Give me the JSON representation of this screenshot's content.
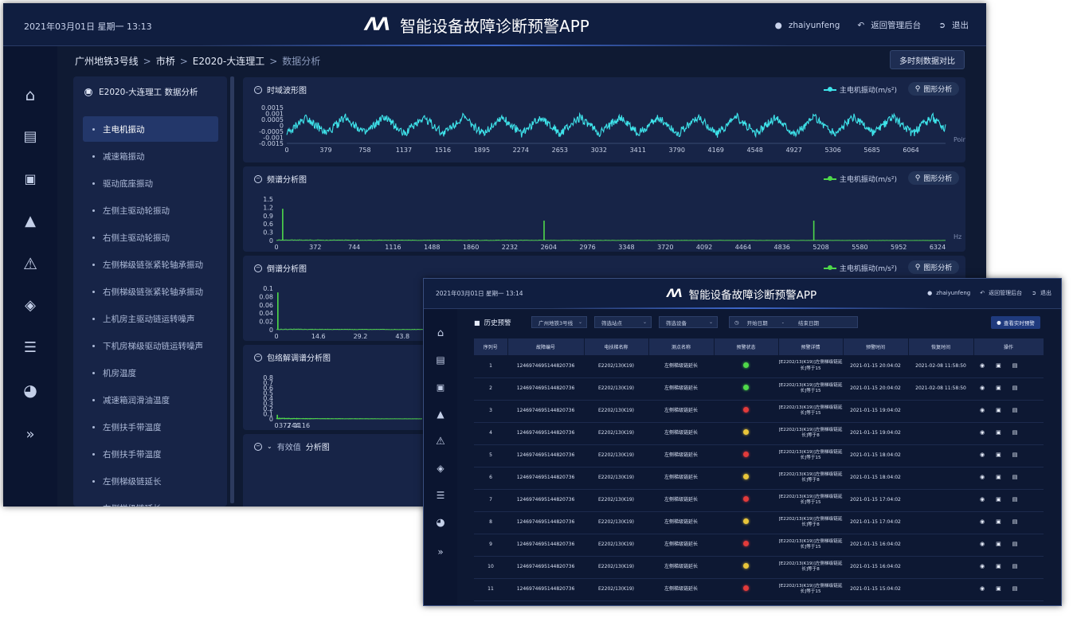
{
  "w1": {
    "datetime": "2021年03月01日 星期一 13:13",
    "title": "智能设备故障诊断预警APP",
    "logo": "ΛΛ",
    "user": "zhaiyunfeng",
    "back_admin": "返回管理后台",
    "logout": "退出",
    "breadcrumb": [
      "广州地铁3号线",
      "市桥",
      "E2020-大连理工",
      "数据分析"
    ],
    "multi_compare": "多时刻数据对比",
    "point_panel_title": "E2020-大连理工 数据分析",
    "points": [
      "主电机振动",
      "减速箱振动",
      "驱动底座振动",
      "左侧主驱动轮振动",
      "右侧主驱动轮振动",
      "左侧梯级链张紧轮轴承振动",
      "右侧梯级链张紧轮轴承振动",
      "上机房主驱动链运转噪声",
      "下机房梯级驱动链运转噪声",
      "机房温度",
      "减速箱润滑油温度",
      "左侧扶手带温度",
      "右侧扶手带温度",
      "左侧梯级链延长",
      "右侧梯级链延长"
    ],
    "active_point": 0,
    "nav_icons": [
      "home-icon",
      "train-icon",
      "router-icon",
      "alarm-light-icon",
      "warning-icon",
      "drop-icon",
      "list-icon",
      "pie-chart-icon",
      "expand-icon"
    ],
    "panels": [
      {
        "title": "时域波形图",
        "legend": "主电机振动(m/s²)",
        "button": "图形分析",
        "unit": "Point"
      },
      {
        "title": "频谱分析图",
        "legend": "主电机振动(m/s²)",
        "button": "图形分析",
        "unit": "Hz"
      },
      {
        "title": "倒谱分析图",
        "legend": "主电机振动(m/s²)",
        "button": "图形分析",
        "unit": ""
      },
      {
        "title": "包络解调谱分析图",
        "legend": "",
        "button": "",
        "unit": ""
      },
      {
        "title": "有效值",
        "title2": "分析图",
        "legend": "",
        "button": "",
        "unit": ""
      }
    ],
    "colors": {
      "bg": "#0f1a33",
      "panel": "#172447",
      "cyan": "#3ee3ea",
      "green": "#4fd94a"
    }
  },
  "chart_data": [
    {
      "type": "line",
      "title": "时域波形图",
      "xlabel": "Point",
      "x_ticks": [
        0,
        379,
        758,
        1137,
        1516,
        1895,
        2274,
        2653,
        3032,
        3411,
        3790,
        4169,
        4548,
        4927,
        5306,
        5685,
        6064
      ],
      "y_ticks": [
        0.0015,
        0.001,
        0.0005,
        0,
        -0.0005,
        -0.001,
        -0.0015
      ],
      "y_tick_labels": [
        "0.0015",
        "0.001",
        "0.0005",
        "0",
        "-0.0005",
        "-0.001",
        "-0.0015"
      ],
      "ylim": [
        -0.0015,
        0.0015
      ],
      "xlim": [
        0,
        6400
      ],
      "series": [
        {
          "name": "主电机振动(m/s²)",
          "pattern": "triangle wave with noise",
          "period": 380,
          "amplitude": 0.0007,
          "noise": 0.00035
        }
      ]
    },
    {
      "type": "line",
      "title": "频谱分析图",
      "xlabel": "Hz",
      "x_ticks": [
        0,
        372,
        744,
        1116,
        1488,
        1860,
        2232,
        2604,
        2976,
        3348,
        3720,
        4092,
        4464,
        4836,
        5208,
        5580,
        5952,
        6324
      ],
      "y_ticks": [
        1.5,
        1.2,
        0.9,
        0.6,
        0.3,
        0
      ],
      "y_tick_labels": [
        "1.5",
        "1.2",
        "0.9",
        "0.6",
        "0.3",
        "0"
      ],
      "ylim": [
        0,
        1.5
      ],
      "xlim": [
        0,
        6400
      ],
      "series": [
        {
          "name": "主电机振动(m/s²)",
          "peaks": [
            {
              "x": 60,
              "y": 1.15
            },
            {
              "x": 2560,
              "y": 0.72
            },
            {
              "x": 5140,
              "y": 0.72
            }
          ]
        }
      ]
    },
    {
      "type": "line",
      "title": "倒谱分析图",
      "x_ticks": [
        0,
        14.6,
        29.2,
        43.8
      ],
      "y_ticks": [
        0.1,
        0.08,
        0.06,
        0.04,
        0.02,
        0
      ],
      "y_tick_labels": [
        "0.1",
        "0.08",
        "0.06",
        "0.04",
        "0.02",
        "0"
      ],
      "ylim": [
        0,
        0.1
      ],
      "xlim": [
        0,
        160
      ],
      "series": [
        {
          "name": "主电机振动(m/s²)",
          "peaks": [
            {
              "x": 0.5,
              "y": 0.09
            }
          ]
        }
      ]
    },
    {
      "type": "line",
      "title": "包络解调谱分析图",
      "x_ticks": [
        0,
        372,
        744,
        1116
      ],
      "y_ticks": [
        0.8,
        0.7,
        0.6,
        0.5,
        0.4,
        0.3,
        0.2,
        0.1,
        0
      ],
      "y_tick_labels": [
        "0.8",
        "0.7",
        "0.6",
        "0.5",
        "0.4",
        "0.3",
        "0.2",
        "0.1",
        "0"
      ],
      "ylim": [
        0,
        0.8
      ],
      "xlim": [
        0,
        6400
      ],
      "series": [
        {
          "name": "",
          "peaks": [
            {
              "x": 40,
              "y": 0.08
            }
          ]
        }
      ]
    }
  ],
  "w2": {
    "datetime": "2021年03月01日 星期一 13:14",
    "title": "智能设备故障诊断预警APP",
    "logo": "ΛΛ",
    "user": "zhaiyunfeng",
    "back_admin": "返回管理后台",
    "logout": "退出",
    "section_title": "历史预警",
    "filters": [
      "广州地铁3号线",
      "筛选站点",
      "筛选设备"
    ],
    "start_date": "开始日期",
    "sep": "-",
    "end_date": "结束日期",
    "realtime_button": "查看实时预警",
    "columns": [
      "序列号",
      "故障编号",
      "电扶梯名称",
      "测点名称",
      "预警状态",
      "预警详情",
      "预警时间",
      "恢复时间",
      "操作"
    ],
    "rows": [
      {
        "no": "1",
        "code": "1246974695144820736",
        "name": "E2202/13(K19)",
        "point": "左侧梯级链延长",
        "status": "green",
        "detail": "[E2202/13(K19)]左侧梯级链延长]等于15",
        "time": "2021-01-15 20:04:02",
        "recover": "2021-02-08 11:58:50"
      },
      {
        "no": "2",
        "code": "1246974695144820736",
        "name": "E2202/13(K19)",
        "point": "左侧梯级链延长",
        "status": "green",
        "detail": "[E2202/13(K19)]左侧梯级链延长]等于15",
        "time": "2021-01-15 20:04:02",
        "recover": "2021-02-08 11:58:50"
      },
      {
        "no": "3",
        "code": "1246974695144820736",
        "name": "E2202/13(K19)",
        "point": "左侧梯级链延长",
        "status": "red",
        "detail": "[E2202/13(K19)]左侧梯级链延长]等于15",
        "time": "2021-01-15 19:04:02",
        "recover": ""
      },
      {
        "no": "4",
        "code": "1246974695144820736",
        "name": "E2202/13(K19)",
        "point": "左侧梯级链延长",
        "status": "yellow",
        "detail": "[E2202/13(K19)]左侧梯级链延长]等于8",
        "time": "2021-01-15 19:04:02",
        "recover": ""
      },
      {
        "no": "5",
        "code": "1246974695144820736",
        "name": "E2202/13(K19)",
        "point": "左侧梯级链延长",
        "status": "red",
        "detail": "[E2202/13(K19)]左侧梯级链延长]等于15",
        "time": "2021-01-15 18:04:02",
        "recover": ""
      },
      {
        "no": "6",
        "code": "1246974695144820736",
        "name": "E2202/13(K19)",
        "point": "左侧梯级链延长",
        "status": "yellow",
        "detail": "[E2202/13(K19)]左侧梯级链延长]等于8",
        "time": "2021-01-15 18:04:02",
        "recover": ""
      },
      {
        "no": "7",
        "code": "1246974695144820736",
        "name": "E2202/13(K19)",
        "point": "左侧梯级链延长",
        "status": "red",
        "detail": "[E2202/13(K19)]左侧梯级链延长]等于15",
        "time": "2021-01-15 17:04:02",
        "recover": ""
      },
      {
        "no": "8",
        "code": "1246974695144820736",
        "name": "E2202/13(K19)",
        "point": "左侧梯级链延长",
        "status": "yellow",
        "detail": "[E2202/13(K19)]左侧梯级链延长]等于8",
        "time": "2021-01-15 17:04:02",
        "recover": ""
      },
      {
        "no": "9",
        "code": "1246974695144820736",
        "name": "E2202/13(K19)",
        "point": "左侧梯级链延长",
        "status": "red",
        "detail": "[E2202/13(K19)]左侧梯级链延长]等于15",
        "time": "2021-01-15 16:04:02",
        "recover": ""
      },
      {
        "no": "10",
        "code": "1246974695144820736",
        "name": "E2202/13(K19)",
        "point": "左侧梯级链延长",
        "status": "yellow",
        "detail": "[E2202/13(K19)]左侧梯级链延长]等于8",
        "time": "2021-01-15 16:04:02",
        "recover": ""
      },
      {
        "no": "11",
        "code": "1246974695144820736",
        "name": "E2202/13(K19)",
        "point": "左侧梯级链延长",
        "status": "red",
        "detail": "[E2202/13(K19)]左侧梯级链延长]等于15",
        "time": "2021-01-15 15:04:02",
        "recover": ""
      }
    ],
    "status_colors": {
      "green": "#4fd94a",
      "red": "#e23b3b",
      "yellow": "#e8c53a"
    },
    "ops": [
      "eye-icon",
      "check-icon",
      "edit-icon"
    ]
  }
}
